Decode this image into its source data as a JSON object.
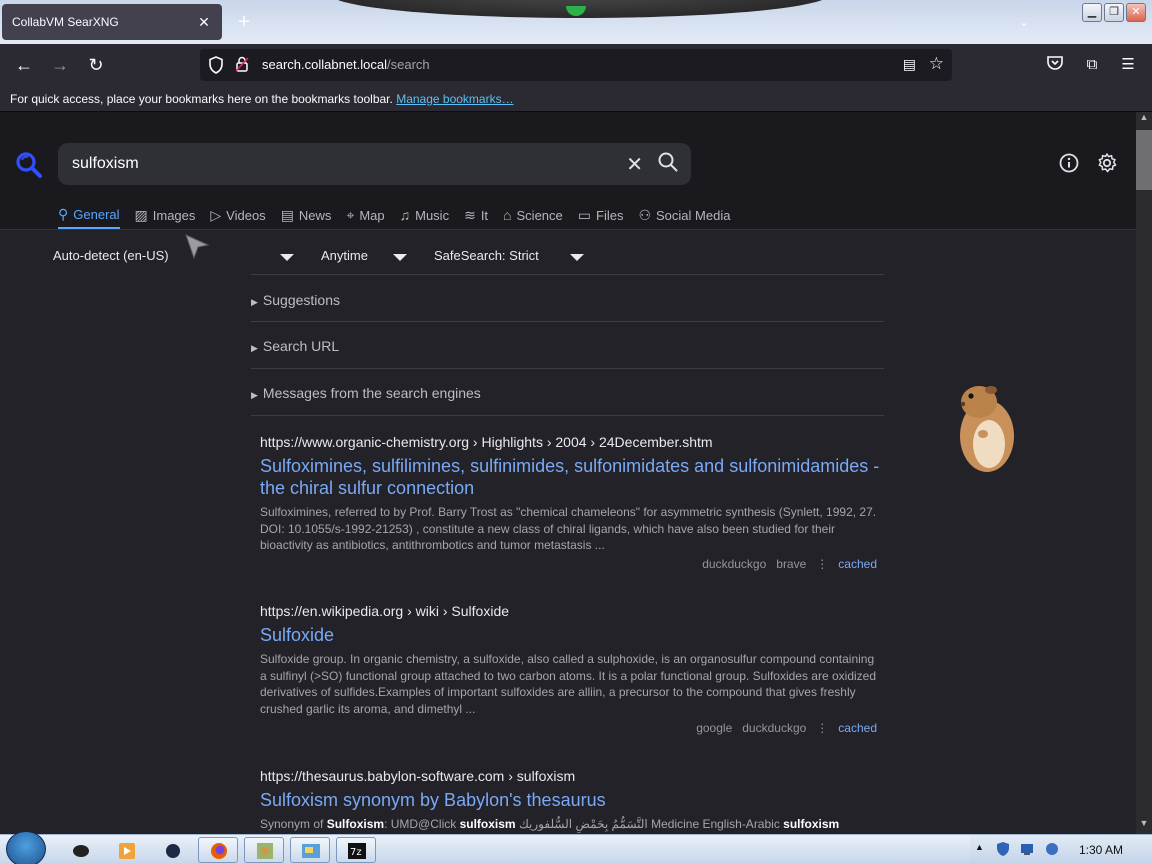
{
  "browser": {
    "tab_title": "CollabVM SearXNG",
    "url_domain": "search.collabnet.local",
    "url_path": "/search",
    "bookmarks_hint": "For quick access, place your bookmarks here on the bookmarks toolbar.",
    "bookmarks_link": "Manage bookmarks…"
  },
  "search": {
    "query": "sulfoxism",
    "categories": [
      {
        "label": "General",
        "icon": "search-icon",
        "active": true
      },
      {
        "label": "Images",
        "icon": "image-icon"
      },
      {
        "label": "Videos",
        "icon": "play-icon"
      },
      {
        "label": "News",
        "icon": "newspaper-icon"
      },
      {
        "label": "Map",
        "icon": "map-pin-icon"
      },
      {
        "label": "Music",
        "icon": "music-icon"
      },
      {
        "label": "It",
        "icon": "layers-icon"
      },
      {
        "label": "Science",
        "icon": "graduation-cap-icon"
      },
      {
        "label": "Files",
        "icon": "files-icon"
      },
      {
        "label": "Social Media",
        "icon": "people-icon"
      }
    ],
    "filters": {
      "language": "Auto-detect (en-US)",
      "time": "Anytime",
      "safesearch": "SafeSearch: Strict"
    },
    "details": [
      "Suggestions",
      "Search URL",
      "Messages from the search engines"
    ]
  },
  "results": [
    {
      "url": "https://www.organic-chemistry.org",
      "breadcrumb": " › Highlights › 2004 › 24December.shtm",
      "title": "Sulfoximines, sulfilimines, sulfinimides, sulfonimidates and sulfonimidamides - the chiral sulfur connection",
      "content": "Sulfoximines, referred to by Prof. Barry Trost as \"chemical chameleons\" for asymmetric synthesis (Synlett, 1992, 27. DOI: 10.1055/s-1992-21253) , constitute a new class of chiral ligands, which have also been studied for their bioactivity as antibiotics, antithrombotics and tumor metastasis ...",
      "engines": [
        "duckduckgo",
        "brave"
      ],
      "cached": "cached"
    },
    {
      "url": "https://en.wikipedia.org",
      "breadcrumb": " › wiki › Sulfoxide",
      "title": "Sulfoxide",
      "content": "Sulfoxide group. In organic chemistry, a sulfoxide, also called a sulphoxide, is an organosulfur compound containing a sulfinyl (>SO) functional group attached to two carbon atoms. It is a polar functional group. Sulfoxides are oxidized derivatives of sulfides.Examples of important sulfoxides are alliin, a precursor to the compound that gives freshly crushed garlic its aroma, and dimethyl ...",
      "engines": [
        "google",
        "duckduckgo"
      ],
      "cached": "cached"
    },
    {
      "url": "https://thesaurus.babylon-software.com",
      "breadcrumb": " › sulfoxism",
      "title": "Sulfoxism synonym by Babylon's thesaurus",
      "content_parts": [
        "Synonym of ",
        "Sulfoxism",
        ": UMD@Click ",
        "sulfoxism",
        " التَّسَمُّمُ بِحَمْضِ السُّلفوريك Medicine English-Arabic ",
        "sulfoxism"
      ]
    }
  ],
  "taskbar": {
    "clock": "1:30 AM"
  },
  "colors": {
    "accent": "#58a6ff",
    "link": "#7aa9f6",
    "background": "#222228"
  }
}
